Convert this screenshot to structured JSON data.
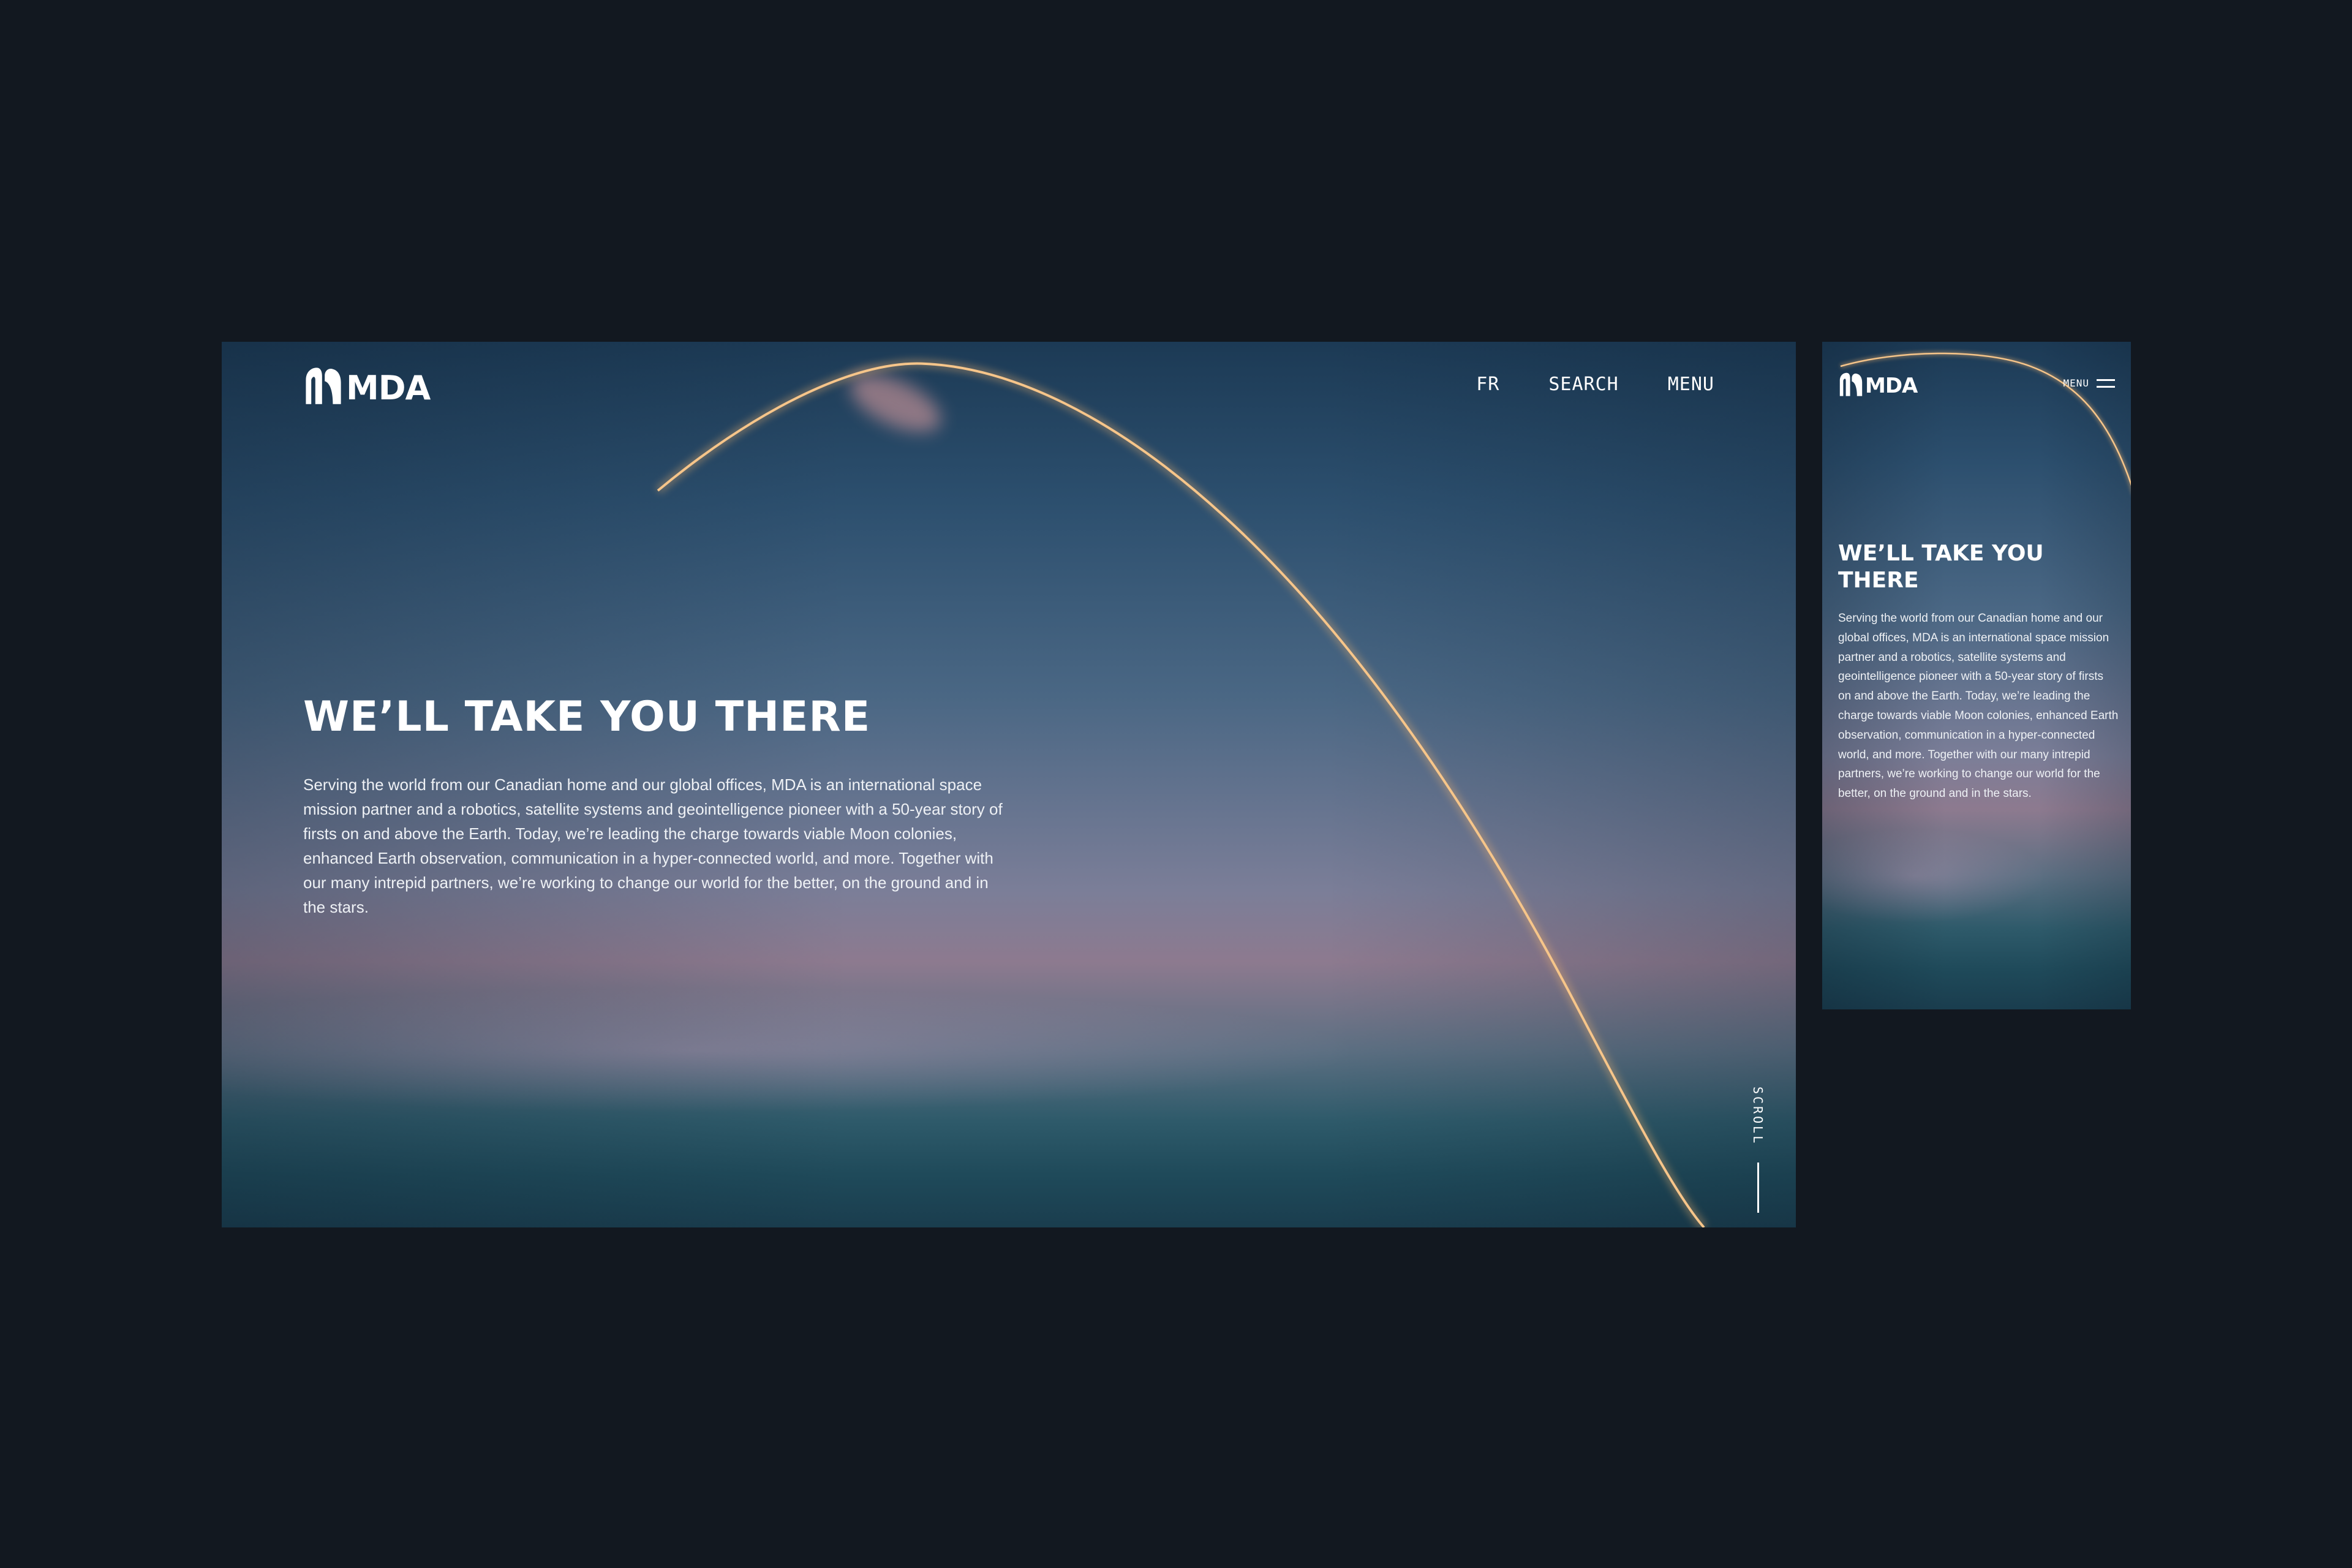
{
  "brand": {
    "name": "MDA",
    "logo_icon": "mda-arch-logo",
    "text_color": "#ffffff"
  },
  "desktop": {
    "nav": {
      "language": "FR",
      "search": "SEARCH",
      "menu": "MENU"
    },
    "hero": {
      "title": "WE’LL TAKE YOU THERE",
      "body": "Serving the world from our Canadian home and our global offices, MDA is an international space mission partner and a robotics, satellite systems and geointelligence pioneer with a 50-year story of firsts on and above the Earth. Today, we’re leading the charge towards viable Moon colonies, enhanced Earth observation, communication in a hyper-connected world, and more. Together with our many intrepid partners, we’re working to change our world for the better, on the ground and in the stars."
    },
    "scroll_label": "SCROLL"
  },
  "mobile": {
    "menu_label": "MENU",
    "menu_icon": "hamburger-icon",
    "hero": {
      "title": "WE’LL TAKE YOU THERE",
      "body": "Serving the world from our Canadian home and our global offices, MDA is an international space mission partner and a robotics, satellite systems and geointelligence pioneer with a 50-year story of firsts on and above the Earth. Today, we’re leading the charge towards viable Moon colonies, enhanced Earth observation, communication in a hyper-connected world, and more. Together with our many intrepid partners, we’re working to change our world for the better, on the ground and in the stars."
    }
  },
  "colors": {
    "page_background": "#121820",
    "trail": "#e8a56a",
    "sky_top": "#1c3a55",
    "sky_horizon": "#8d7a8f"
  }
}
